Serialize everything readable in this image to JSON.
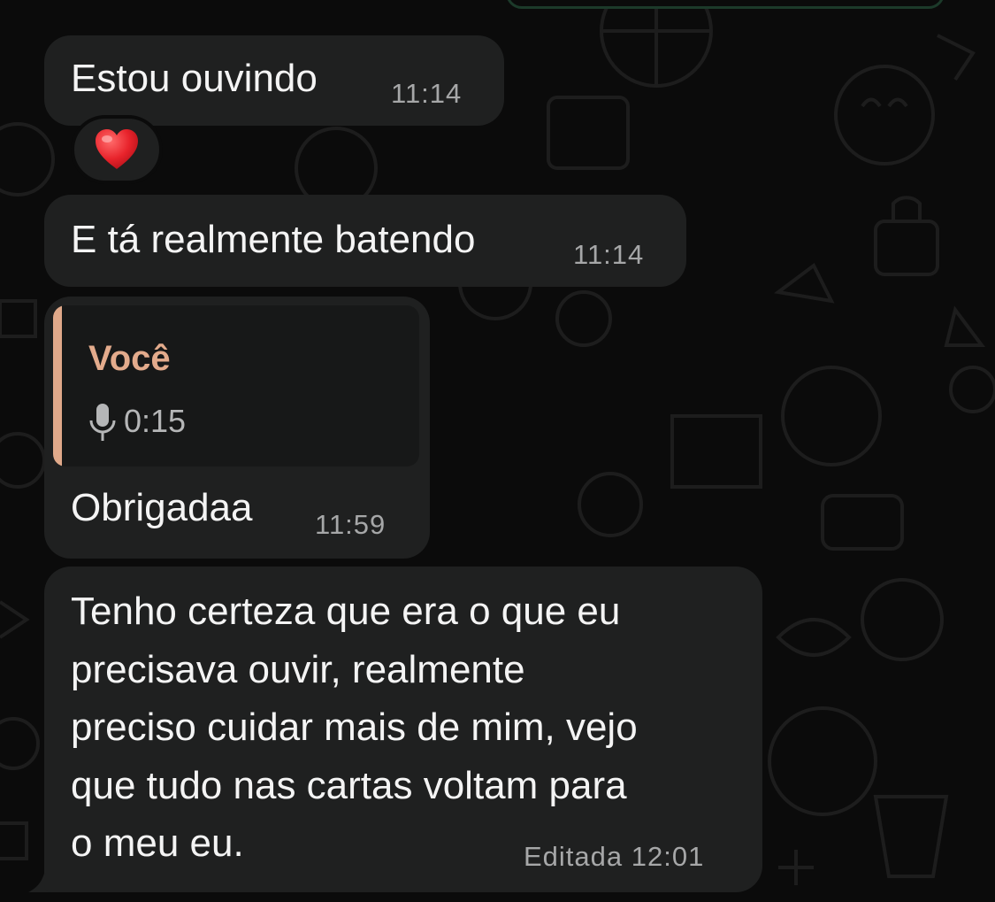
{
  "messages": [
    {
      "text": "Estou ouvindo",
      "time": "11:14",
      "reaction": "heart"
    },
    {
      "text": "E tá realmente batendo",
      "time": "11:14"
    },
    {
      "quote": {
        "author": "Você",
        "duration": "0:15",
        "accent": "#e3ab8c"
      },
      "text": "Obrigadaa",
      "time": "11:59"
    },
    {
      "lines": [
        "Tenho certeza que era o que eu",
        "precisava ouvir, realmente",
        "preciso cuidar mais de mim, vejo",
        "que tudo nas cartas voltam para",
        "o meu eu."
      ],
      "edited_label": "Editada",
      "time": "12:01"
    }
  ],
  "colors": {
    "background": "#0b0b0b",
    "bubble": "#1f2020",
    "quote_bar": "#e0a98a",
    "heart": "#e8232b"
  }
}
